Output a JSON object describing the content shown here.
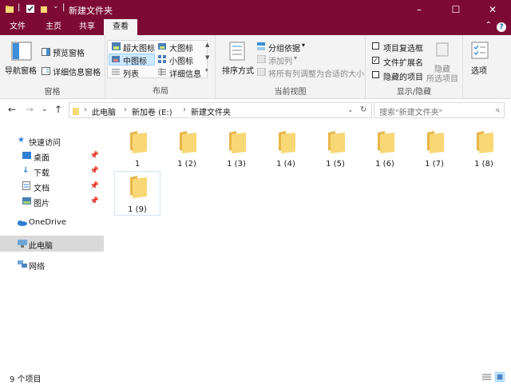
{
  "window": {
    "title": "新建文件夹",
    "minimize": "–",
    "maximize": "☐",
    "close": "✕"
  },
  "tabs": [
    {
      "label": "文件"
    },
    {
      "label": "主页"
    },
    {
      "label": "共享"
    },
    {
      "label": "查看"
    }
  ],
  "ribbon": {
    "panes": {
      "label": "窗格",
      "nav_pane": "导航窗格",
      "preview_pane": "预览窗格",
      "details_pane": "详细信息窗格"
    },
    "layout": {
      "label": "布局",
      "extra_large": "超大图标",
      "large": "大图标",
      "medium": "中图标",
      "small": "小图标",
      "list": "列表",
      "details": "详细信息"
    },
    "current_view": {
      "label": "当前视图",
      "sort_by": "排序方式",
      "group_by": "分组依据",
      "add_columns": "添加列",
      "size_all_columns": "将所有列调整为合适的大小"
    },
    "show_hide": {
      "label": "显示/隐藏",
      "item_checkboxes": "项目复选框",
      "item_checkboxes_checked": false,
      "file_extensions": "文件扩展名",
      "file_extensions_checked": true,
      "hidden_items": "隐藏的项目",
      "hidden_items_checked": false,
      "hide_selected": "隐藏\n所选项目"
    },
    "options": "选项"
  },
  "address": {
    "path": [
      "此电脑",
      "新加卷 (E:)",
      "新建文件夹"
    ],
    "search_placeholder": "搜索\"新建文件夹\""
  },
  "nav": [
    {
      "label": "快速访问",
      "icon": "star-icon"
    },
    {
      "label": "桌面",
      "icon": "desktop-icon",
      "pinned": true
    },
    {
      "label": "下载",
      "icon": "download-icon",
      "pinned": true
    },
    {
      "label": "文档",
      "icon": "document-icon",
      "pinned": true
    },
    {
      "label": "图片",
      "icon": "picture-icon",
      "pinned": true
    },
    {
      "label": "OneDrive",
      "icon": "cloud-icon"
    },
    {
      "label": "此电脑",
      "icon": "computer-icon",
      "selected": true
    },
    {
      "label": "网络",
      "icon": "network-icon"
    }
  ],
  "files": [
    {
      "name": "1"
    },
    {
      "name": "1 (2)"
    },
    {
      "name": "1 (3)"
    },
    {
      "name": "1 (4)"
    },
    {
      "name": "1 (5)"
    },
    {
      "name": "1 (6)"
    },
    {
      "name": "1 (7)"
    },
    {
      "name": "1 (8)"
    },
    {
      "name": "1 (9)"
    }
  ],
  "status": {
    "item_count": "9 个项目"
  },
  "colors": {
    "accent": "#7d0a34",
    "folder": "#f8d775",
    "selection": "#cce8ff"
  }
}
